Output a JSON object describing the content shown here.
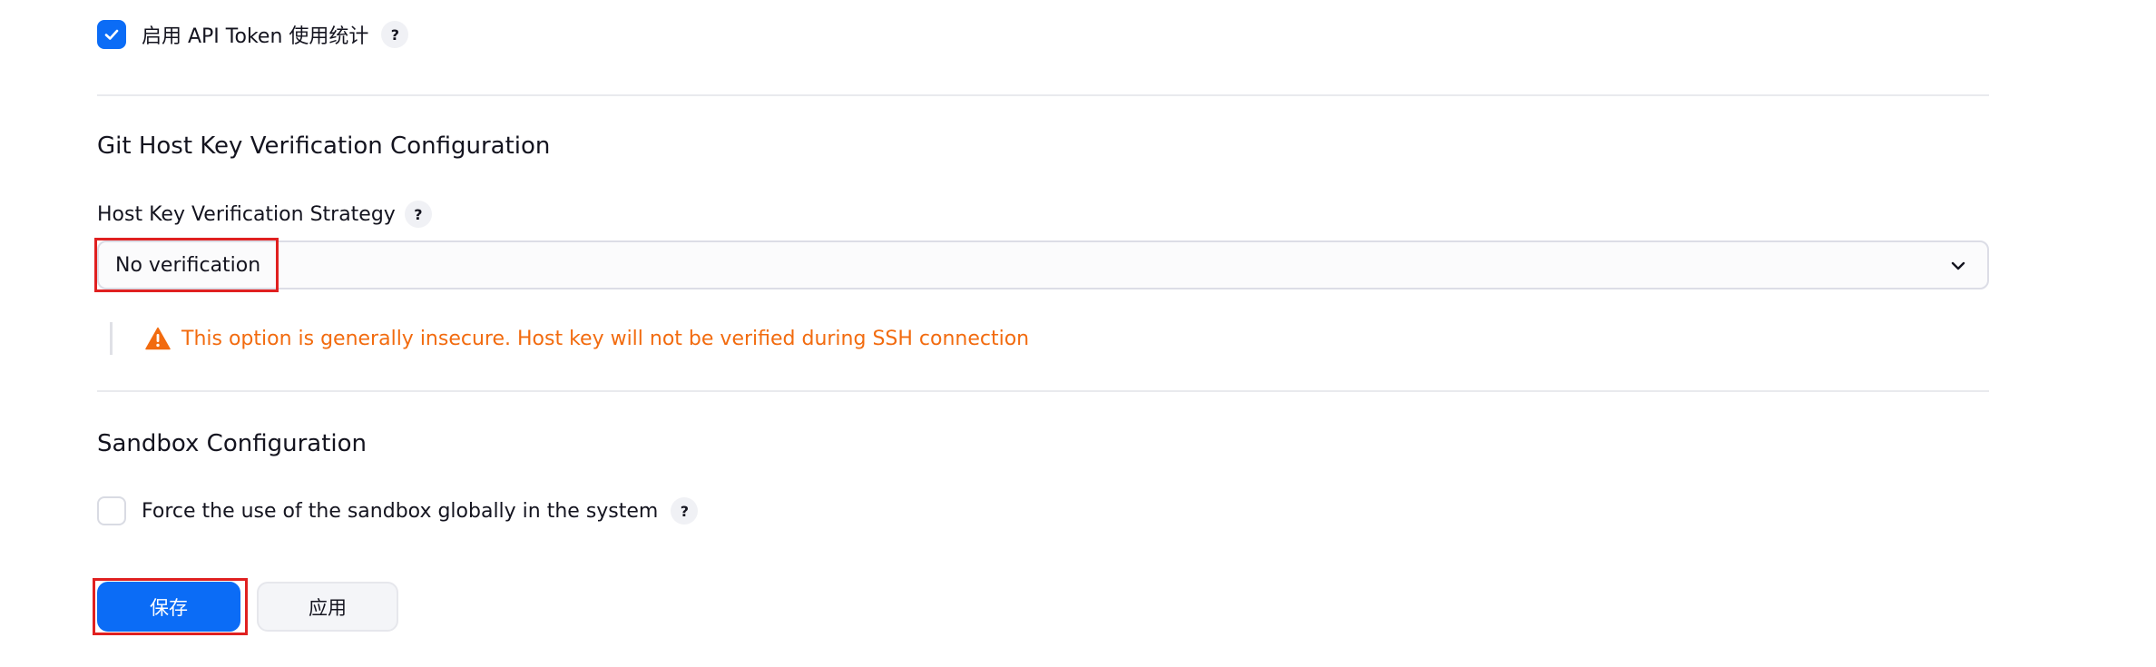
{
  "api_token_stats": {
    "label": "启用 API Token 使用统计",
    "checked": true,
    "help": "?"
  },
  "git_host_key": {
    "section_title": "Git Host Key Verification Configuration",
    "strategy_label": "Host Key Verification Strategy",
    "help": "?",
    "selected_value": "No verification",
    "warning_text": "This option is generally insecure. Host key will not be verified during SSH connection"
  },
  "sandbox": {
    "section_title": "Sandbox Configuration",
    "force_label": "Force the use of the sandbox globally in the system",
    "checked": false,
    "help": "?"
  },
  "actions": {
    "save_label": "保存",
    "apply_label": "应用"
  },
  "colors": {
    "primary": "#0b6cf6",
    "warning": "#f26b0f",
    "highlight": "#e02020"
  },
  "icons": [
    "check-icon",
    "help-icon",
    "chevron-down-icon",
    "warning-icon"
  ]
}
